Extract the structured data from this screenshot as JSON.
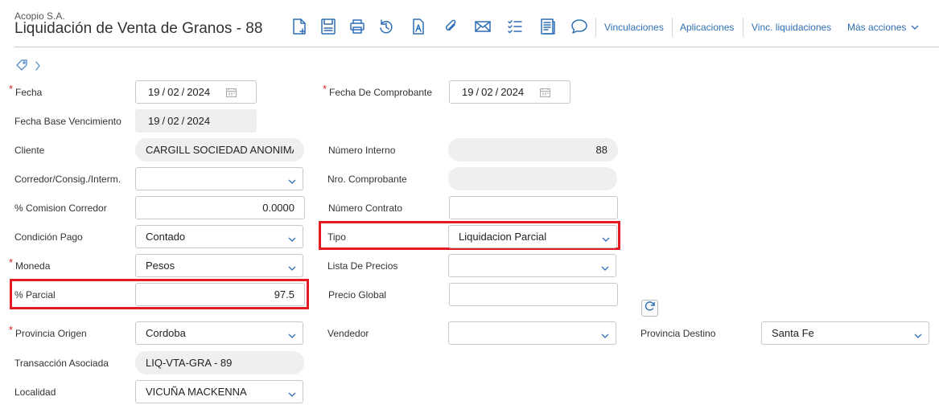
{
  "header": {
    "company": "Acopio S.A.",
    "title": "Liquidación de Venta de Granos - 88"
  },
  "toolbar": {
    "icons": [
      "new-document-icon",
      "save-icon",
      "print-icon",
      "history-icon",
      "text-document-icon",
      "attachment-icon",
      "email-icon",
      "checklist-icon",
      "report-icon",
      "comment-icon"
    ],
    "links": {
      "vinculaciones": "Vinculaciones",
      "aplicaciones": "Aplicaciones",
      "vinc_liquidaciones": "Vinc. liquidaciones",
      "mas_acciones": "Más acciones"
    }
  },
  "form": {
    "fecha": {
      "label": "Fecha",
      "day": "19",
      "month": "02",
      "year": "2024"
    },
    "fecha_comprobante": {
      "label": "Fecha De Comprobante",
      "day": "19",
      "month": "02",
      "year": "2024"
    },
    "fecha_base_vencimiento": {
      "label": "Fecha Base Vencimiento",
      "day": "19",
      "month": "02",
      "year": "2024"
    },
    "cliente": {
      "label": "Cliente",
      "value": "CARGILL SOCIEDAD ANONIMA"
    },
    "numero_interno": {
      "label": "Número Interno",
      "value": "88"
    },
    "corredor": {
      "label": "Corredor/Consig./Interm.",
      "value": ""
    },
    "nro_comprobante": {
      "label": "Nro. Comprobante",
      "value": ""
    },
    "comision_corredor": {
      "label": "% Comision Corredor",
      "value": "0.0000"
    },
    "numero_contrato": {
      "label": "Número Contrato",
      "value": ""
    },
    "condicion_pago": {
      "label": "Condición Pago",
      "value": "Contado"
    },
    "tipo": {
      "label": "Tipo",
      "value": "Liquidacion Parcial"
    },
    "moneda": {
      "label": "Moneda",
      "value": "Pesos"
    },
    "lista_precios": {
      "label": "Lista De Precios",
      "value": ""
    },
    "parcial": {
      "label": "% Parcial",
      "value": "97.5"
    },
    "precio_global": {
      "label": "Precio Global",
      "value": ""
    },
    "provincia_origen": {
      "label": "Provincia Origen",
      "value": "Cordoba"
    },
    "vendedor": {
      "label": "Vendedor",
      "value": ""
    },
    "provincia_destino": {
      "label": "Provincia Destino",
      "value": "Santa Fe"
    },
    "transaccion_asociada": {
      "label": "Transacción Asociada",
      "value": "LIQ-VTA-GRA - 89"
    },
    "localidad": {
      "label": "Localidad",
      "value": "VICUÑA MACKENNA"
    }
  },
  "colors": {
    "accent": "#2f6fb3",
    "required": "#e02020",
    "highlight": "#e31b23",
    "readonly_bg": "#efefef"
  }
}
